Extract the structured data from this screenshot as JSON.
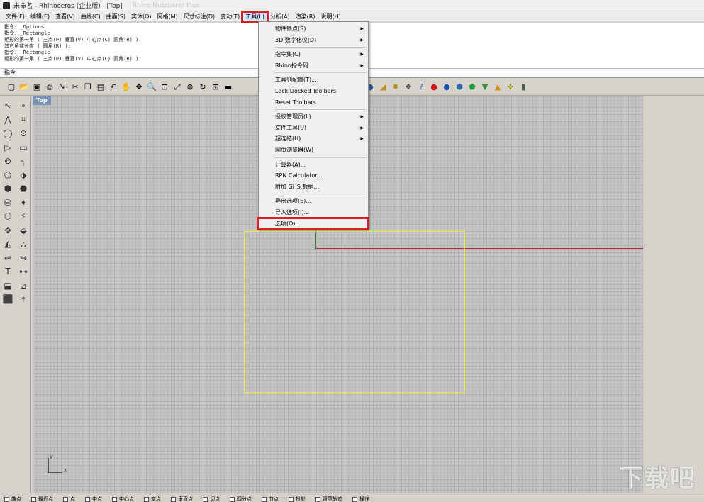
{
  "window": {
    "title": "未命名 - Rhinoceros (企业版) - [Top]",
    "ghost_title": "Rhino Nutzbarer Plus"
  },
  "menubar": {
    "items": [
      {
        "label": "文件(F)"
      },
      {
        "label": "编辑(E)"
      },
      {
        "label": "查看(V)"
      },
      {
        "label": "曲线(C)"
      },
      {
        "label": "曲面(S)"
      },
      {
        "label": "实体(O)"
      },
      {
        "label": "网格(M)"
      },
      {
        "label": "尺寸标注(D)"
      },
      {
        "label": "变动(T)"
      },
      {
        "label": "工具(L)",
        "active": true
      },
      {
        "label": "分析(A)"
      },
      {
        "label": "渲染(R)"
      },
      {
        "label": "说明(H)"
      }
    ]
  },
  "command_history": [
    "指令: _Options",
    "指令: _Rectangle",
    "矩形的第一角 ( 三点(P)  垂直(V)  中心点(C)  圆角(R) ):",
    "其它角或长度 ( 圆角(R) ):",
    "指令: _Rectangle",
    "矩形的第一角 ( 三点(P)  垂直(V)  中心点(C)  圆角(R) ):"
  ],
  "command_prompt": "指令:",
  "tools_menu": {
    "items": [
      {
        "label": "物件锁点(S)",
        "submenu": true
      },
      {
        "label": "3D 数字化仪(D)",
        "submenu": true
      },
      {
        "separator": true
      },
      {
        "label": "指令集(C)",
        "submenu": true
      },
      {
        "label": "Rhino指令码",
        "submenu": true
      },
      {
        "separator": true
      },
      {
        "label": "工具列配置(T)...",
        "submenu": false
      },
      {
        "label": "Lock Docked Toolbars",
        "submenu": false
      },
      {
        "label": "Reset Toolbars",
        "submenu": false
      },
      {
        "separator": true
      },
      {
        "label": "授权管理员(L)",
        "submenu": true
      },
      {
        "label": "文件工具(U)",
        "submenu": true
      },
      {
        "label": "超连结(H)",
        "submenu": true
      },
      {
        "label": "网页浏览器(W)",
        "submenu": false
      },
      {
        "separator": true
      },
      {
        "label": "计算器(A)...",
        "submenu": false
      },
      {
        "label": "RPN Calculator...",
        "submenu": false
      },
      {
        "label": "附加 GHS 数据...",
        "submenu": false
      },
      {
        "separator": true
      },
      {
        "label": "导出选项(E)...",
        "submenu": false
      },
      {
        "label": "导入选项(I)...",
        "submenu": false
      },
      {
        "label": "选项(O)...",
        "submenu": false,
        "highlighted": true
      }
    ],
    "submenu_glyph": "▶"
  },
  "toolbar_icons": [
    {
      "name": "new-icon",
      "glyph": "▢"
    },
    {
      "name": "open-icon",
      "glyph": "📂"
    },
    {
      "name": "save-icon",
      "glyph": "▣"
    },
    {
      "name": "print-icon",
      "glyph": "⎙"
    },
    {
      "name": "import-icon",
      "glyph": "⇲"
    },
    {
      "name": "cut-icon",
      "glyph": "✂"
    },
    {
      "name": "copy-icon",
      "glyph": "❐"
    },
    {
      "name": "paste-icon",
      "glyph": "▤"
    },
    {
      "name": "undo-icon",
      "glyph": "↶"
    },
    {
      "name": "pan-icon",
      "glyph": "✋"
    },
    {
      "name": "rotate-view-icon",
      "glyph": "✥"
    },
    {
      "name": "zoom-icon",
      "glyph": "🔍"
    },
    {
      "name": "zoom-window-icon",
      "glyph": "⊡"
    },
    {
      "name": "zoom-extents-icon",
      "glyph": "⤢"
    },
    {
      "name": "zoom-selected-icon",
      "glyph": "⊕"
    },
    {
      "name": "undo-view-icon",
      "glyph": "↻"
    },
    {
      "name": "four-viewports-icon",
      "glyph": "⊞"
    },
    {
      "name": "car-icon",
      "glyph": "▬"
    }
  ],
  "toolbar_icons_right": [
    {
      "name": "render-globe-icon",
      "glyph": "◍",
      "color": "#3a5fa8"
    },
    {
      "name": "render-sphere-icon",
      "glyph": "●",
      "color": "#2e5a9e"
    },
    {
      "name": "light-icon",
      "glyph": "◢",
      "color": "#c08a18"
    },
    {
      "name": "settings-gear-icon",
      "glyph": "✸",
      "color": "#b58b1a"
    },
    {
      "name": "options-icon",
      "glyph": "❖",
      "color": "#4a4a4a"
    },
    {
      "name": "help-icon",
      "glyph": "?",
      "color": "#2a4fb0"
    },
    {
      "name": "red-sphere-icon",
      "glyph": "●",
      "color": "#cc1111"
    },
    {
      "name": "blue-sphere-icon",
      "glyph": "●",
      "color": "#1f4fb6"
    },
    {
      "name": "material-icon",
      "glyph": "⬢",
      "color": "#2a6ab0"
    },
    {
      "name": "green-shield-icon",
      "glyph": "⬟",
      "color": "#2a9a3a"
    },
    {
      "name": "green-cup-icon",
      "glyph": "▼",
      "color": "#2f8f2f"
    },
    {
      "name": "cone-icon",
      "glyph": "▲",
      "color": "#d88a10"
    },
    {
      "name": "frame-icon",
      "glyph": "✜",
      "color": "#a0a010"
    },
    {
      "name": "cylinder-icon",
      "glyph": "▮",
      "color": "#406040"
    }
  ],
  "left_toolbar_icons": [
    "select-arrow-icon",
    "point-icon",
    "polyline-icon",
    "rectangle-points-icon",
    "circle-icon",
    "ellipse-icon",
    "curve-icon",
    "rectangle-icon",
    "circle-center-icon",
    "fillet-curve-icon",
    "surface-icon",
    "loft-icon",
    "box-solid-icon",
    "boolean-icon",
    "cylinder-solid-icon",
    "mesh-icon",
    "transform-icon",
    "explode-icon",
    "move-icon",
    "join-icon",
    "shade-icon",
    "group-icon",
    "curve-from-object-icon",
    "blend-icon",
    "text-icon",
    "snap-node-icon",
    "array-icon",
    "flow-icon",
    "render-box-icon",
    "dimension-icon"
  ],
  "left_toolbar_glyphs": [
    "↖",
    "∘",
    "⋀",
    "⌗",
    "◯",
    "⊙",
    "▷",
    "▭",
    "⊚",
    "╮",
    "⬠",
    "⬗",
    "⬢",
    "⬣",
    "⛁",
    "⬧",
    "⬡",
    "⚡",
    "✥",
    "⬙",
    "◭",
    "⛬",
    "↩",
    "↪",
    "T",
    "⊶",
    "⬓",
    "⊿",
    "⬛",
    "⤒"
  ],
  "viewport": {
    "label": "Top",
    "axis_x_label": "x",
    "axis_y_label": "y",
    "rectangle_color": "#e8e84a"
  },
  "status_snaps": [
    "端点",
    "最近点",
    "点",
    "中点",
    "中心点",
    "交点",
    "垂直点",
    "切点",
    "四分点",
    "节点",
    "投影",
    "智慧轨迹",
    "操作"
  ],
  "watermark": "下载吧",
  "colors": {
    "highlight_box": "#e01c24",
    "axis_x": "#b03030",
    "axis_y": "#2a8a2a",
    "viewport_label_bg": "#7891b5"
  }
}
